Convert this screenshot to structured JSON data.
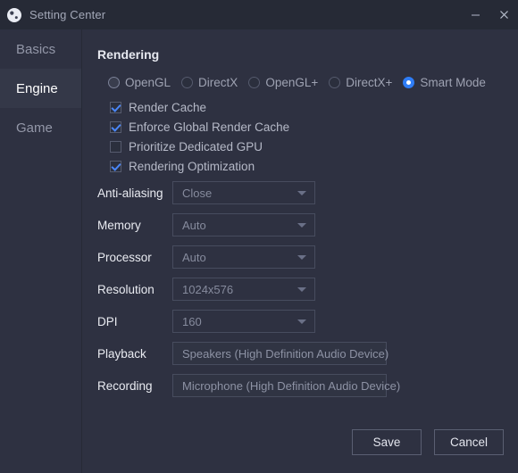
{
  "window": {
    "title": "Setting Center",
    "app_icon": "moon-logo-icon",
    "minimize_label": "Minimize",
    "close_label": "Close"
  },
  "sidebar": {
    "items": [
      {
        "label": "Basics",
        "active": false
      },
      {
        "label": "Engine",
        "active": true
      },
      {
        "label": "Game",
        "active": false
      }
    ]
  },
  "main": {
    "section_title": "Rendering",
    "render_modes": [
      {
        "label": "OpenGL",
        "selected": false
      },
      {
        "label": "DirectX",
        "selected": false
      },
      {
        "label": "OpenGL+",
        "selected": false
      },
      {
        "label": "DirectX+",
        "selected": false
      },
      {
        "label": "Smart Mode",
        "selected": true
      }
    ],
    "checkboxes": [
      {
        "label": "Render Cache",
        "checked": true
      },
      {
        "label": "Enforce Global Render Cache",
        "checked": true
      },
      {
        "label": "Prioritize Dedicated GPU",
        "checked": false
      },
      {
        "label": "Rendering Optimization",
        "checked": true
      }
    ],
    "fields": [
      {
        "label": "Anti-aliasing",
        "value": "Close",
        "type": "select"
      },
      {
        "label": "Memory",
        "value": "Auto",
        "type": "select"
      },
      {
        "label": "Processor",
        "value": "Auto",
        "type": "select"
      },
      {
        "label": "Resolution",
        "value": "1024x576",
        "type": "select"
      },
      {
        "label": "DPI",
        "value": "160",
        "type": "select"
      },
      {
        "label": "Playback",
        "value": "Speakers (High Definition Audio Device)",
        "type": "field"
      },
      {
        "label": "Recording",
        "value": "Microphone (High Definition Audio Device)",
        "type": "field"
      }
    ]
  },
  "footer": {
    "save_label": "Save",
    "cancel_label": "Cancel"
  },
  "colors": {
    "titlebar_bg": "#262a36",
    "body_bg": "#2e3141",
    "active_nav_bg": "#343848",
    "accent_blue": "#2f7df6",
    "check_blue": "#4a86f7"
  }
}
